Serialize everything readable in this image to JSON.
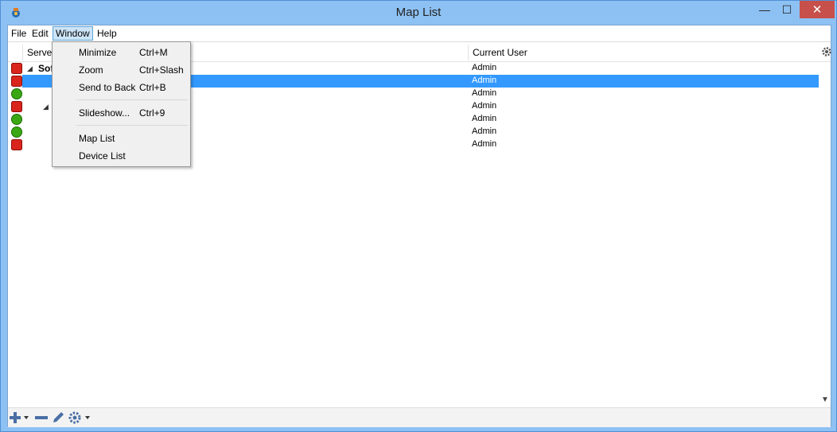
{
  "window": {
    "title": "Map List",
    "minimize_glyph": "—",
    "maximize_glyph": "☐",
    "close_glyph": "✕"
  },
  "menubar": {
    "items": [
      "File",
      "Edit",
      "Window",
      "Help"
    ],
    "active": "Window"
  },
  "columns": {
    "server": "Server",
    "current_user": "Current User"
  },
  "tree": {
    "root_label": "Sof"
  },
  "rows": [
    {
      "status": "red",
      "user": "Admin",
      "selected": false
    },
    {
      "status": "red",
      "user": "Admin",
      "selected": true
    },
    {
      "status": "green",
      "user": "Admin",
      "selected": false
    },
    {
      "status": "red",
      "user": "Admin",
      "selected": false
    },
    {
      "status": "green",
      "user": "Admin",
      "selected": false
    },
    {
      "status": "green",
      "user": "Admin",
      "selected": false
    },
    {
      "status": "red",
      "user": "Admin",
      "selected": false
    }
  ],
  "window_menu": {
    "items": [
      {
        "label": "Minimize",
        "shortcut": "Ctrl+M"
      },
      {
        "label": "Zoom",
        "shortcut": "Ctrl+Slash"
      },
      {
        "label": "Send to Back",
        "shortcut": "Ctrl+B"
      },
      {
        "label": "Slideshow...",
        "shortcut": "Ctrl+9"
      },
      {
        "label": "Map List",
        "shortcut": ""
      },
      {
        "label": "Device List",
        "shortcut": ""
      }
    ]
  },
  "toolbar": {
    "icons": [
      "add-icon",
      "remove-icon",
      "edit-icon",
      "settings-icon"
    ]
  },
  "colors": {
    "selection": "#3399ff",
    "status_red": "#d9251c",
    "status_green": "#3aa815",
    "title_bar": "#8dc1f3"
  }
}
